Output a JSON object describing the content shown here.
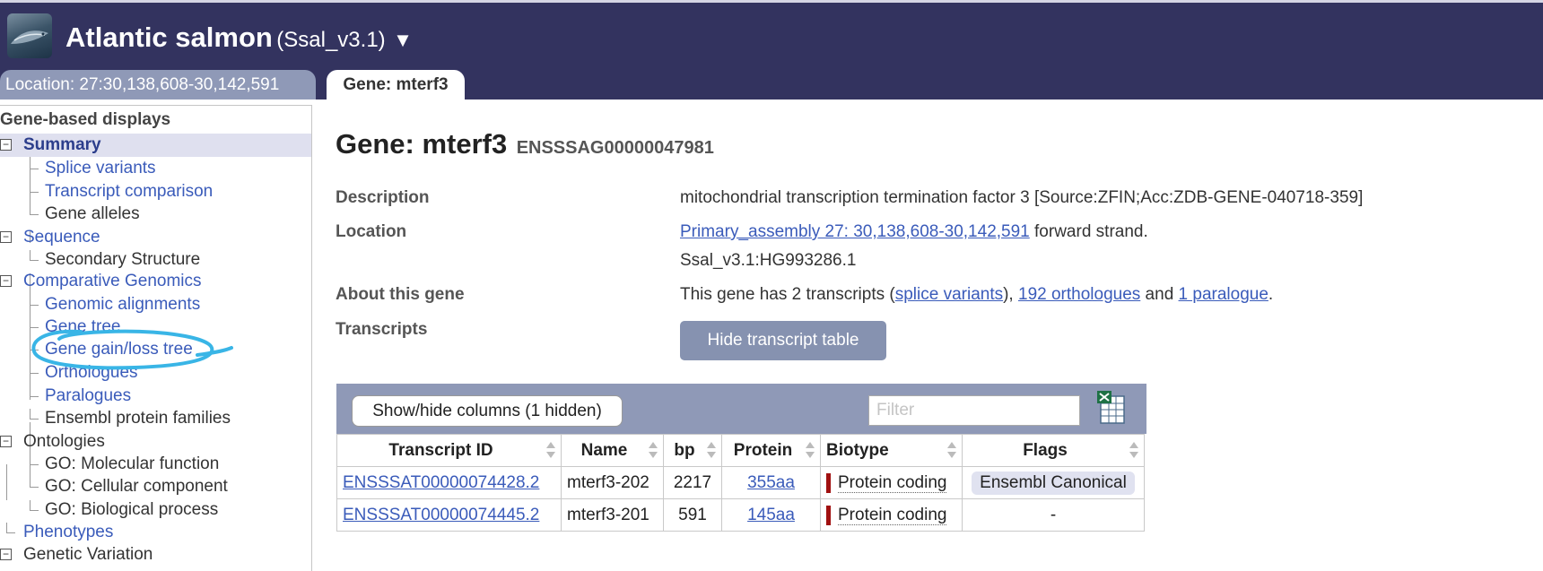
{
  "header": {
    "species": "Atlantic salmon",
    "assembly": "(Ssal_v3.1)",
    "caret": "▼",
    "logo_icon": "salmon-logo-icon"
  },
  "tabs": {
    "location": "Location: 27:30,138,608-30,142,591",
    "gene": "Gene: mterf3"
  },
  "sidebar": {
    "heading": "Gene-based displays",
    "summary": "Summary",
    "splice_variants": "Splice variants",
    "transcript_comparison": "Transcript comparison",
    "gene_alleles": "Gene alleles",
    "sequence": "Sequence",
    "secondary_structure": "Secondary Structure",
    "comparative_genomics": "Comparative Genomics",
    "genomic_alignments": "Genomic alignments",
    "gene_tree": "Gene tree",
    "gene_gain_loss_tree": "Gene gain/loss tree",
    "orthologues": "Orthologues",
    "paralogues": "Paralogues",
    "ensembl_protein_families": "Ensembl protein families",
    "ontologies": "Ontologies",
    "go_molecular": "GO: Molecular function",
    "go_cellular": "GO: Cellular component",
    "go_biological": "GO: Biological process",
    "phenotypes": "Phenotypes",
    "genetic_variation": "Genetic Variation",
    "collapse_symbol": "−"
  },
  "main": {
    "title": "Gene: mterf3",
    "stable_id": "ENSSSAG00000047981",
    "description_label": "Description",
    "description": "mitochondrial transcription termination factor 3 [Source:ZFIN;Acc:ZDB-GENE-040718-359]",
    "location_label": "Location",
    "location_link": "Primary_assembly 27: 30,138,608-30,142,591",
    "location_suffix": " forward strand.",
    "location_alt": "Ssal_v3.1:HG993286.1",
    "about_label": "About this gene",
    "about_prefix": "This gene has 2 transcripts (",
    "about_splice": "splice variants",
    "about_mid1": "), ",
    "about_orthologues": "192 orthologues",
    "about_mid2": " and ",
    "about_paralogue": "1 paralogue",
    "about_end": ".",
    "transcripts_label": "Transcripts",
    "hide_button": "Hide transcript table"
  },
  "transcript_table": {
    "showhide_button": "Show/hide columns (1 hidden)",
    "filter_placeholder": "Filter",
    "export_icon": "excel-export-icon",
    "columns": [
      "Transcript ID",
      "Name",
      "bp",
      "Protein",
      "Biotype",
      "Flags"
    ],
    "rows": [
      {
        "id": "ENSSSAT00000074428.2",
        "name": "mterf3-202",
        "bp": "2217",
        "protein": "355aa",
        "biotype": "Protein coding",
        "flags": "Ensembl Canonical"
      },
      {
        "id": "ENSSSAT00000074445.2",
        "name": "mterf3-201",
        "bp": "591",
        "protein": "145aa",
        "biotype": "Protein coding",
        "flags": "-"
      }
    ],
    "biotype_color": "#a01010"
  },
  "colors": {
    "header_bg": "#33335f",
    "tab_inactive": "#8f99b7",
    "link": "#3a5bba",
    "highlight_scribble": "#39b5e6"
  }
}
